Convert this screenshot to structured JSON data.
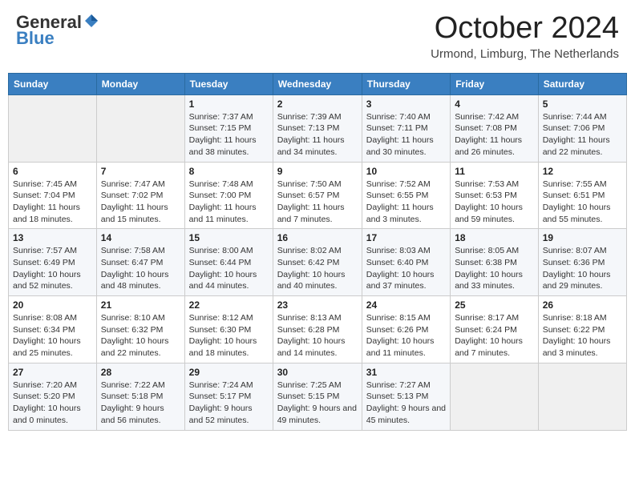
{
  "header": {
    "logo_general": "General",
    "logo_blue": "Blue",
    "month_title": "October 2024",
    "location": "Urmond, Limburg, The Netherlands"
  },
  "days_of_week": [
    "Sunday",
    "Monday",
    "Tuesday",
    "Wednesday",
    "Thursday",
    "Friday",
    "Saturday"
  ],
  "weeks": [
    [
      {
        "day": "",
        "info": ""
      },
      {
        "day": "",
        "info": ""
      },
      {
        "day": "1",
        "info": "Sunrise: 7:37 AM\nSunset: 7:15 PM\nDaylight: 11 hours and 38 minutes."
      },
      {
        "day": "2",
        "info": "Sunrise: 7:39 AM\nSunset: 7:13 PM\nDaylight: 11 hours and 34 minutes."
      },
      {
        "day": "3",
        "info": "Sunrise: 7:40 AM\nSunset: 7:11 PM\nDaylight: 11 hours and 30 minutes."
      },
      {
        "day": "4",
        "info": "Sunrise: 7:42 AM\nSunset: 7:08 PM\nDaylight: 11 hours and 26 minutes."
      },
      {
        "day": "5",
        "info": "Sunrise: 7:44 AM\nSunset: 7:06 PM\nDaylight: 11 hours and 22 minutes."
      }
    ],
    [
      {
        "day": "6",
        "info": "Sunrise: 7:45 AM\nSunset: 7:04 PM\nDaylight: 11 hours and 18 minutes."
      },
      {
        "day": "7",
        "info": "Sunrise: 7:47 AM\nSunset: 7:02 PM\nDaylight: 11 hours and 15 minutes."
      },
      {
        "day": "8",
        "info": "Sunrise: 7:48 AM\nSunset: 7:00 PM\nDaylight: 11 hours and 11 minutes."
      },
      {
        "day": "9",
        "info": "Sunrise: 7:50 AM\nSunset: 6:57 PM\nDaylight: 11 hours and 7 minutes."
      },
      {
        "day": "10",
        "info": "Sunrise: 7:52 AM\nSunset: 6:55 PM\nDaylight: 11 hours and 3 minutes."
      },
      {
        "day": "11",
        "info": "Sunrise: 7:53 AM\nSunset: 6:53 PM\nDaylight: 10 hours and 59 minutes."
      },
      {
        "day": "12",
        "info": "Sunrise: 7:55 AM\nSunset: 6:51 PM\nDaylight: 10 hours and 55 minutes."
      }
    ],
    [
      {
        "day": "13",
        "info": "Sunrise: 7:57 AM\nSunset: 6:49 PM\nDaylight: 10 hours and 52 minutes."
      },
      {
        "day": "14",
        "info": "Sunrise: 7:58 AM\nSunset: 6:47 PM\nDaylight: 10 hours and 48 minutes."
      },
      {
        "day": "15",
        "info": "Sunrise: 8:00 AM\nSunset: 6:44 PM\nDaylight: 10 hours and 44 minutes."
      },
      {
        "day": "16",
        "info": "Sunrise: 8:02 AM\nSunset: 6:42 PM\nDaylight: 10 hours and 40 minutes."
      },
      {
        "day": "17",
        "info": "Sunrise: 8:03 AM\nSunset: 6:40 PM\nDaylight: 10 hours and 37 minutes."
      },
      {
        "day": "18",
        "info": "Sunrise: 8:05 AM\nSunset: 6:38 PM\nDaylight: 10 hours and 33 minutes."
      },
      {
        "day": "19",
        "info": "Sunrise: 8:07 AM\nSunset: 6:36 PM\nDaylight: 10 hours and 29 minutes."
      }
    ],
    [
      {
        "day": "20",
        "info": "Sunrise: 8:08 AM\nSunset: 6:34 PM\nDaylight: 10 hours and 25 minutes."
      },
      {
        "day": "21",
        "info": "Sunrise: 8:10 AM\nSunset: 6:32 PM\nDaylight: 10 hours and 22 minutes."
      },
      {
        "day": "22",
        "info": "Sunrise: 8:12 AM\nSunset: 6:30 PM\nDaylight: 10 hours and 18 minutes."
      },
      {
        "day": "23",
        "info": "Sunrise: 8:13 AM\nSunset: 6:28 PM\nDaylight: 10 hours and 14 minutes."
      },
      {
        "day": "24",
        "info": "Sunrise: 8:15 AM\nSunset: 6:26 PM\nDaylight: 10 hours and 11 minutes."
      },
      {
        "day": "25",
        "info": "Sunrise: 8:17 AM\nSunset: 6:24 PM\nDaylight: 10 hours and 7 minutes."
      },
      {
        "day": "26",
        "info": "Sunrise: 8:18 AM\nSunset: 6:22 PM\nDaylight: 10 hours and 3 minutes."
      }
    ],
    [
      {
        "day": "27",
        "info": "Sunrise: 7:20 AM\nSunset: 5:20 PM\nDaylight: 10 hours and 0 minutes."
      },
      {
        "day": "28",
        "info": "Sunrise: 7:22 AM\nSunset: 5:18 PM\nDaylight: 9 hours and 56 minutes."
      },
      {
        "day": "29",
        "info": "Sunrise: 7:24 AM\nSunset: 5:17 PM\nDaylight: 9 hours and 52 minutes."
      },
      {
        "day": "30",
        "info": "Sunrise: 7:25 AM\nSunset: 5:15 PM\nDaylight: 9 hours and 49 minutes."
      },
      {
        "day": "31",
        "info": "Sunrise: 7:27 AM\nSunset: 5:13 PM\nDaylight: 9 hours and 45 minutes."
      },
      {
        "day": "",
        "info": ""
      },
      {
        "day": "",
        "info": ""
      }
    ]
  ]
}
